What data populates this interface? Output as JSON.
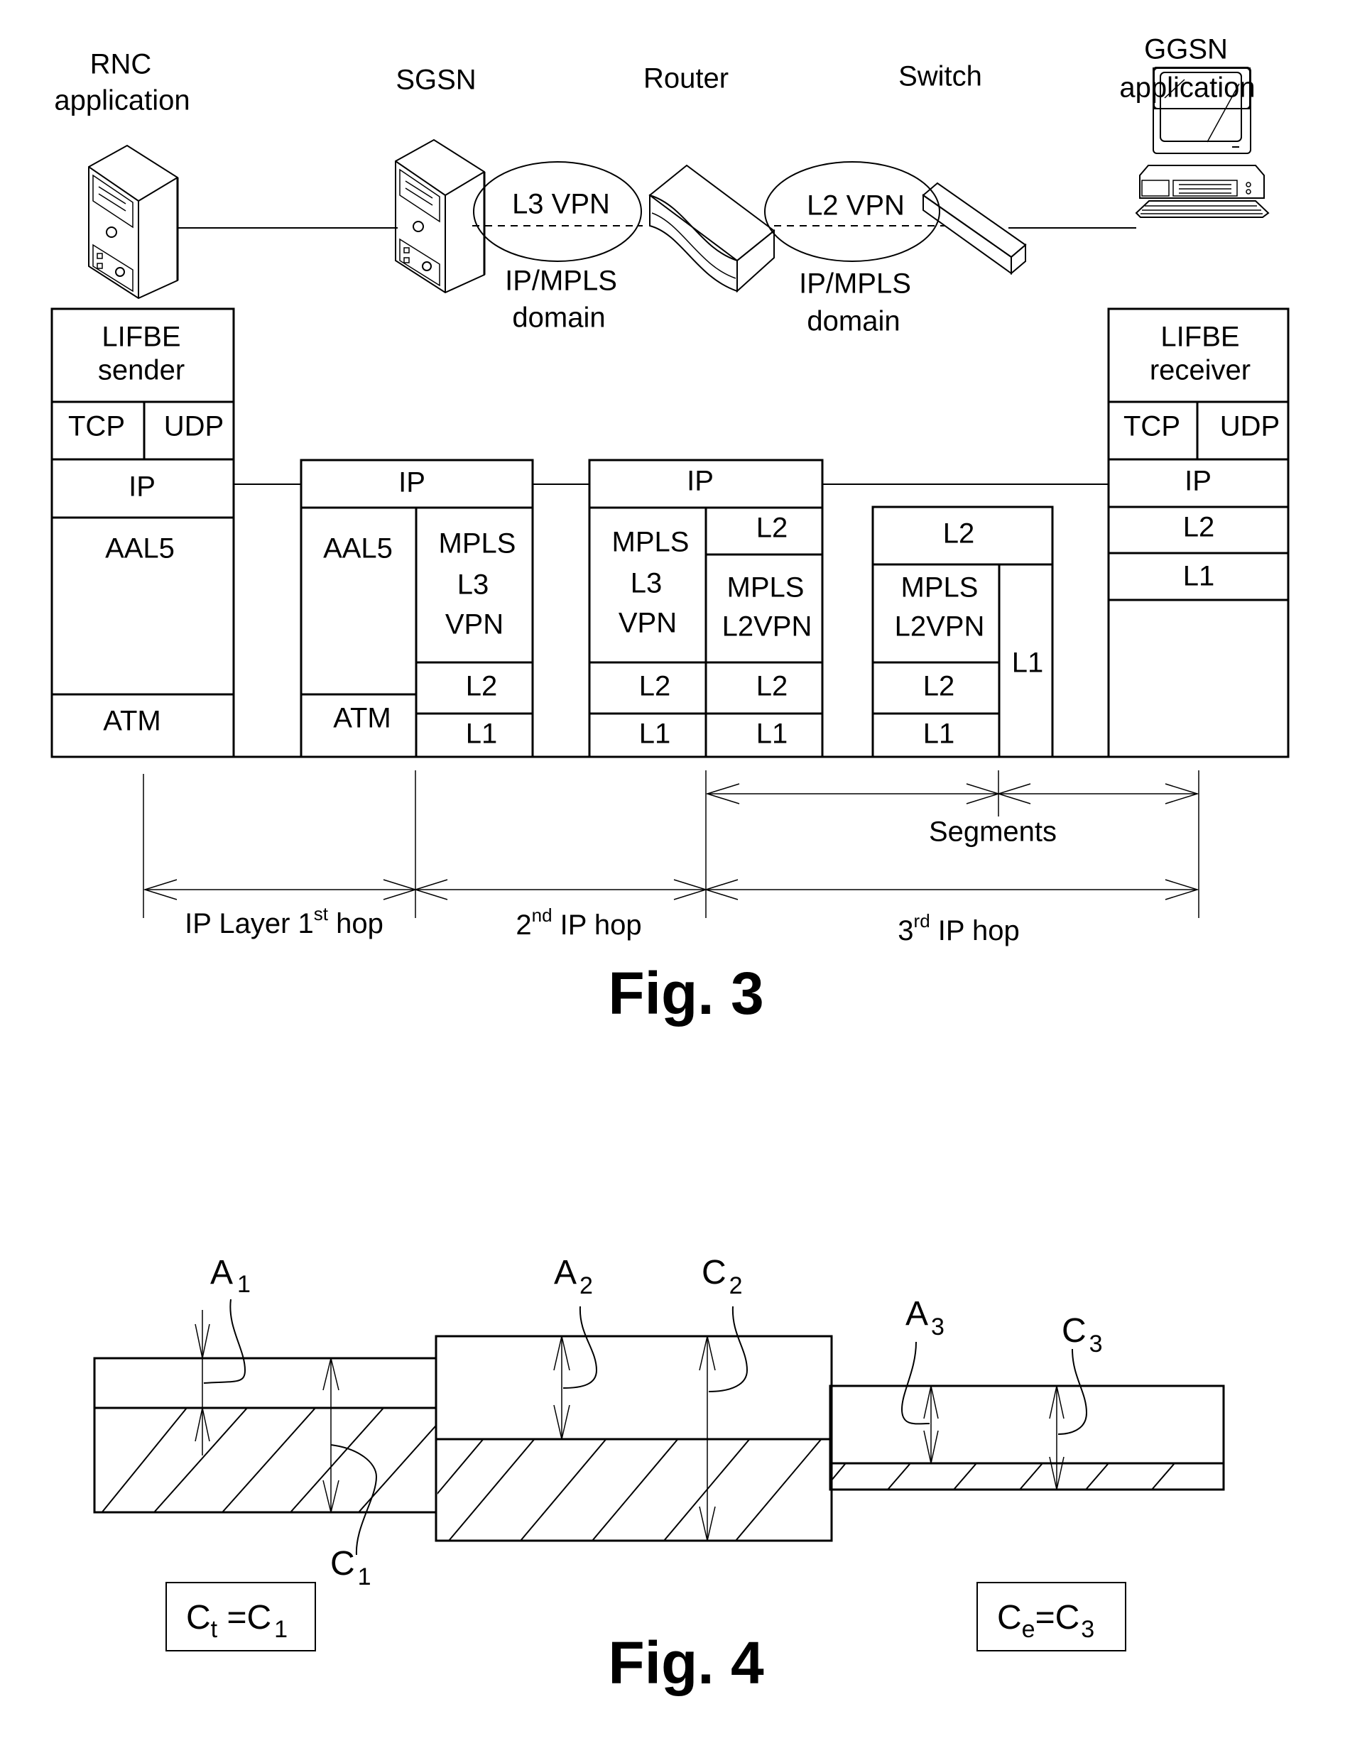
{
  "fig3": {
    "caption": "Fig. 3",
    "nodes": [
      {
        "id": "rnc",
        "label_line1": "RNC",
        "label_line2": "application",
        "icon": "server-tower-icon"
      },
      {
        "id": "sgsn",
        "label_line1": "SGSN",
        "icon": "server-tower-icon"
      },
      {
        "id": "router",
        "label_line1": "Router",
        "icon": "router-icon"
      },
      {
        "id": "switch",
        "label_line1": "Switch",
        "icon": "switch-icon"
      },
      {
        "id": "ggsn",
        "label_line1": "GGSN",
        "label_line2": "application",
        "icon": "desktop-computer-icon"
      }
    ],
    "vpns": [
      {
        "label": "L3 VPN",
        "domain_line1": "IP/MPLS",
        "domain_line2": "domain"
      },
      {
        "label": "L2 VPN",
        "domain_line1": "IP/MPLS",
        "domain_line2": "domain"
      }
    ],
    "stacks": {
      "sender": {
        "app_line1": "LIFBE",
        "app_line2": "sender",
        "tcp": "TCP",
        "udp": "UDP",
        "ip": "IP",
        "aal5": "AAL5",
        "atm": "ATM"
      },
      "sgsn": {
        "ip": "IP",
        "aal5": "AAL5",
        "atm": "ATM",
        "mpls_line1": "MPLS",
        "mpls_line2": "L3",
        "mpls_line3": "VPN",
        "l2": "L2",
        "l1": "L1"
      },
      "router": {
        "ip": "IP",
        "left_mpls_line1": "MPLS",
        "left_mpls_line2": "L3",
        "left_mpls_line3": "VPN",
        "left_l2": "L2",
        "left_l1": "L1",
        "right_top_l2": "L2",
        "right_mpls_line1": "MPLS",
        "right_mpls_line2": "L2VPN",
        "right_l2": "L2",
        "right_l1": "L1"
      },
      "switch": {
        "top_l2": "L2",
        "mpls_line1": "MPLS",
        "mpls_line2": "L2VPN",
        "l2": "L2",
        "l1": "L1",
        "side_l1": "L1"
      },
      "receiver": {
        "app_line1": "LIFBE",
        "app_line2": "receiver",
        "tcp": "TCP",
        "udp": "UDP",
        "ip": "IP",
        "l2": "L2",
        "l1": "L1"
      }
    },
    "segments_label": "Segments",
    "hops": [
      {
        "prefix": "IP Layer 1",
        "sup": "st",
        "suffix": " hop"
      },
      {
        "prefix": "2",
        "sup": "nd",
        "suffix": " IP hop"
      },
      {
        "prefix": "3",
        "sup": "rd",
        "suffix": "  IP hop"
      }
    ]
  },
  "fig4": {
    "caption": "Fig. 4",
    "labels": {
      "a1": {
        "main": "A",
        "sub": "1"
      },
      "a2": {
        "main": "A",
        "sub": "2"
      },
      "c2": {
        "main": "C",
        "sub": "2"
      },
      "a3": {
        "main": "A",
        "sub": "3"
      },
      "c3": {
        "main": "C",
        "sub": "3"
      },
      "c1": {
        "main": "C",
        "sub": "1"
      }
    },
    "equations": [
      {
        "lhs": "C",
        "lhs_sub": "t",
        "eq": " =C",
        "rhs_sub": "1"
      },
      {
        "lhs": "C",
        "lhs_sub": "e",
        "eq": "=C",
        "rhs_sub": "3"
      }
    ]
  }
}
